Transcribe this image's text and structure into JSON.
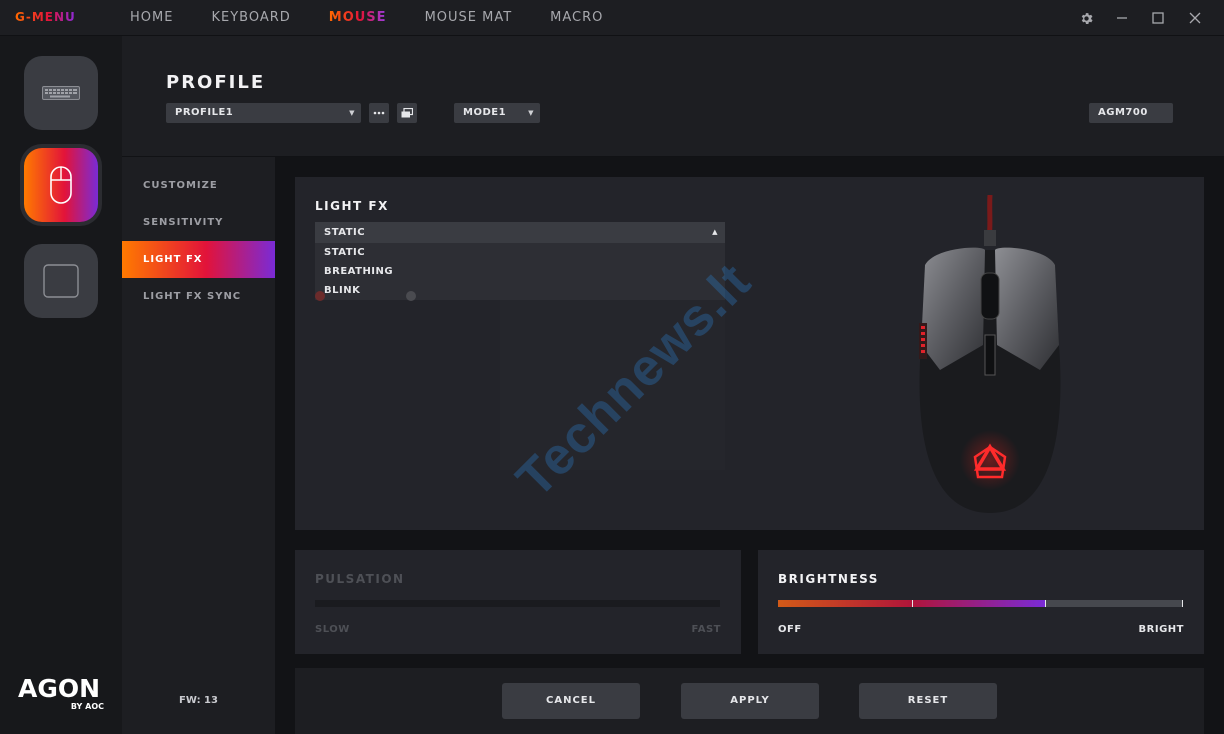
{
  "app": {
    "logo": "G-MENU",
    "nav": [
      "HOME",
      "KEYBOARD",
      "MOUSE",
      "MOUSE MAT",
      "MACRO"
    ],
    "active_nav": "MOUSE",
    "window_controls": [
      "settings",
      "minimize",
      "maximize",
      "close"
    ]
  },
  "rail": {
    "devices": [
      {
        "name": "keyboard-device",
        "icon": "keyboard-icon",
        "active": false
      },
      {
        "name": "mouse-device",
        "icon": "mouse-icon",
        "active": true
      },
      {
        "name": "mousepad-device",
        "icon": "mousepad-icon",
        "active": false
      }
    ],
    "brand_main": "AGON",
    "brand_sub": "BY AOC"
  },
  "header": {
    "title": "PROFILE",
    "profile_value": "PROFILE1",
    "mode_value": "MODE1",
    "device_model": "AGM700"
  },
  "subnav": {
    "items": [
      "CUSTOMIZE",
      "SENSITIVITY",
      "LIGHT FX",
      "LIGHT FX SYNC"
    ],
    "active": "LIGHT FX",
    "fw": "FW: 13"
  },
  "lightfx": {
    "title": "LIGHT FX",
    "selected": "STATIC",
    "options": [
      "STATIC",
      "BREATHING",
      "BLINK"
    ]
  },
  "pulsation": {
    "title": "PULSATION",
    "min_label": "SLOW",
    "max_label": "FAST",
    "enabled": false
  },
  "brightness": {
    "title": "BRIGHTNESS",
    "min_label": "OFF",
    "max_label": "BRIGHT",
    "level": 0.66
  },
  "actions": {
    "cancel": "CANCEL",
    "apply": "APPLY",
    "reset": "RESET"
  },
  "watermark": "Technews.lt",
  "colors": {
    "accent_orange": "#ff7a00",
    "accent_red": "#e2133a",
    "accent_purple": "#7a2bd6",
    "panel": "#23242a",
    "control": "#3a3c42"
  }
}
